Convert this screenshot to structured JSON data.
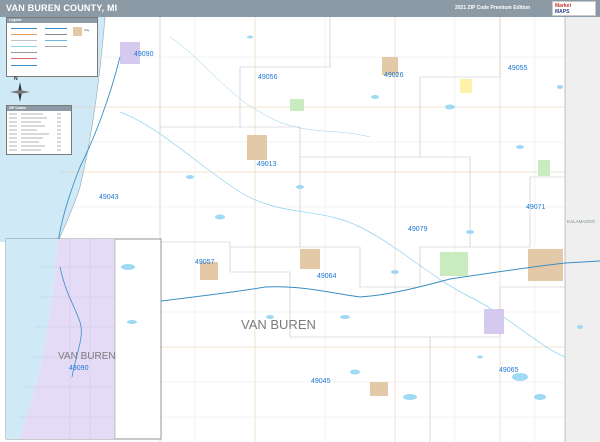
{
  "header": {
    "title": "VAN BUREN COUNTY, MI",
    "edition": "2021 ZIP Code Premium Edition"
  },
  "logo": {
    "line1": "Market",
    "line2": "MAPS"
  },
  "map": {
    "county_label": "VAN BUREN",
    "inset_county_label": "VAN BUREN",
    "neighbor_label": "KALAMAZOO",
    "zip_labels": [
      "49090",
      "49056",
      "49026",
      "49055",
      "49013",
      "49043",
      "49071",
      "49079",
      "49057",
      "49064",
      "49045",
      "49065",
      "49090"
    ],
    "colors": {
      "water": "#9fd9f4",
      "highway": "#3a8fc4",
      "zip_label": "#1f77d4",
      "lake_michigan": "#cfe9f7",
      "city_tan": "#e3c9a8",
      "city_purple": "#d6c9f0",
      "city_green": "#c9ebc0",
      "boundary_gray": "#c2c2c2"
    }
  },
  "legend": {
    "title": "Legend",
    "city_label": "City"
  },
  "compass": {
    "north": "N"
  },
  "zip_table": {
    "title": "ZIP Codes"
  }
}
